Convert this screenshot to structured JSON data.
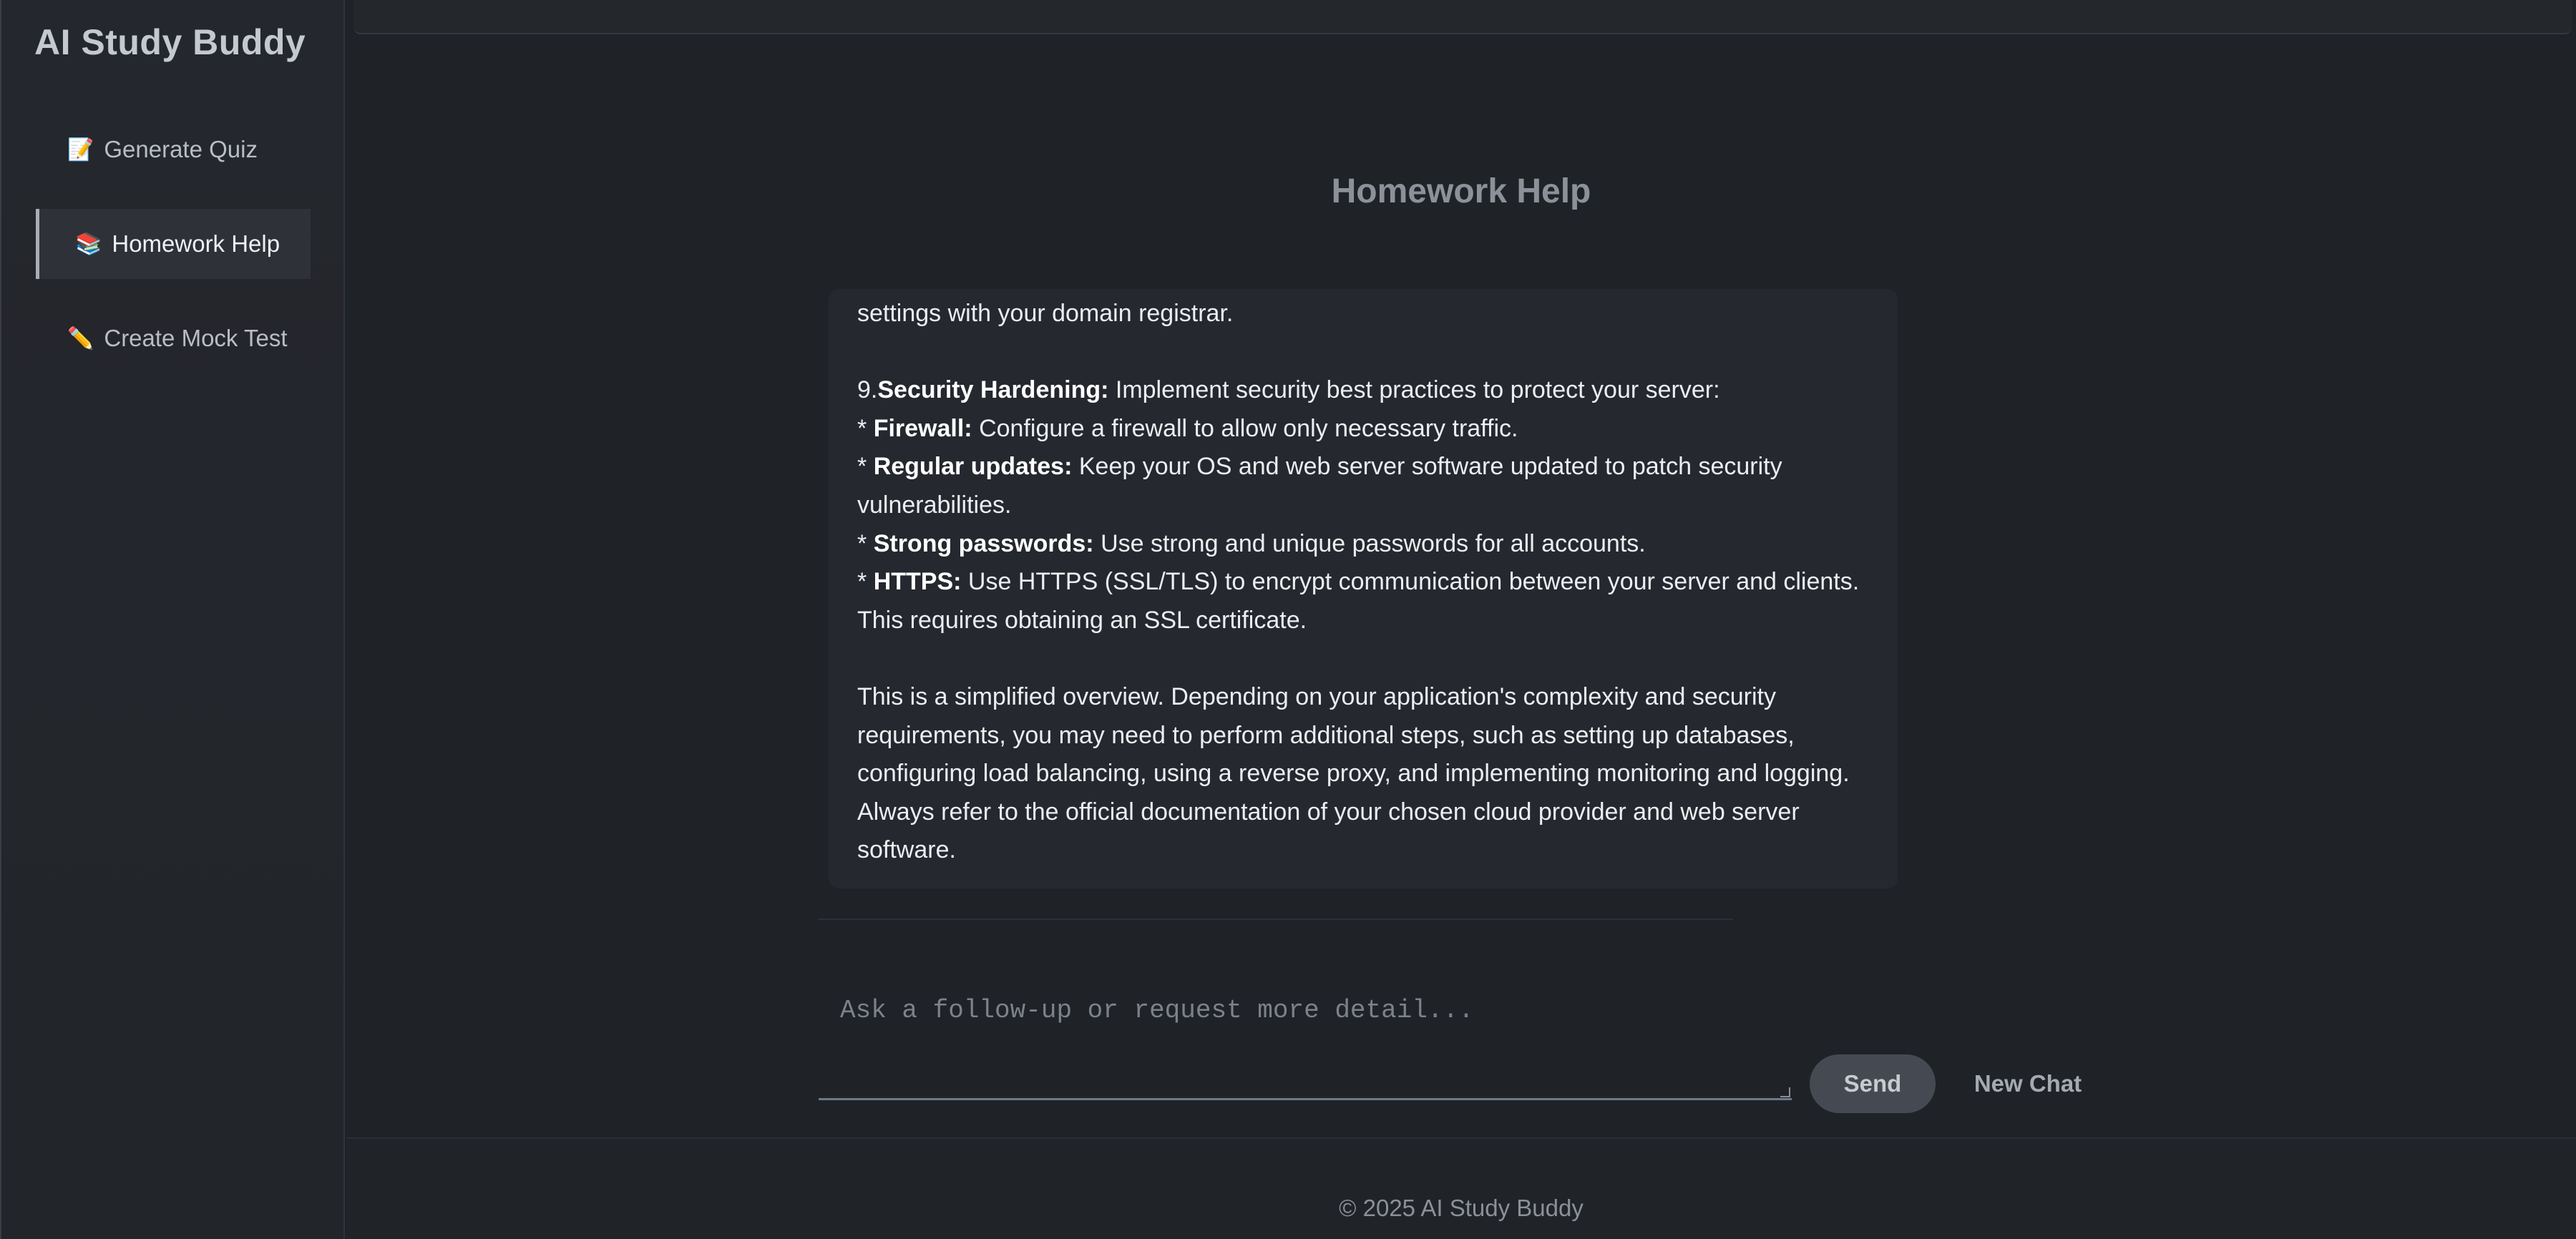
{
  "app": {
    "title": "AI Study Buddy"
  },
  "sidebar": {
    "items": [
      {
        "emoji": "📝",
        "label": "Generate Quiz",
        "active": false
      },
      {
        "emoji": "📚",
        "label": "Homework Help",
        "active": true
      },
      {
        "emoji": "✏️",
        "label": "Create Mock Test",
        "active": false
      }
    ]
  },
  "main": {
    "title": "Homework Help",
    "response": {
      "line1": "settings with your domain registrar.",
      "step9_num": "9.",
      "step9_bold": "Security Hardening:",
      "step9_text": " Implement security best practices to protect your server:",
      "bullets": [
        {
          "prefix": "* ",
          "bold": "Firewall:",
          "text": " Configure a firewall to allow only necessary traffic."
        },
        {
          "prefix": "* ",
          "bold": "Regular updates:",
          "text": " Keep your OS and web server software updated to patch security vulnerabilities."
        },
        {
          "prefix": "* ",
          "bold": "Strong passwords:",
          "text": " Use strong and unique passwords for all accounts."
        },
        {
          "prefix": "* ",
          "bold": "HTTPS:",
          "text": " Use HTTPS (SSL/TLS) to encrypt communication between your server and clients. This requires obtaining an SSL certificate."
        }
      ],
      "closing": "This is a simplified overview. Depending on your application's complexity and security requirements, you may need to perform additional steps, such as setting up databases, configuring load balancing, using a reverse proxy, and implementing monitoring and logging. Always refer to the official documentation of your chosen cloud provider and web server software."
    },
    "composer": {
      "placeholder": "Ask a follow-up or request more detail...",
      "value": "",
      "send_label": "Send",
      "new_chat_label": "New Chat"
    }
  },
  "footer": {
    "text": "© 2025 AI Study Buddy"
  }
}
